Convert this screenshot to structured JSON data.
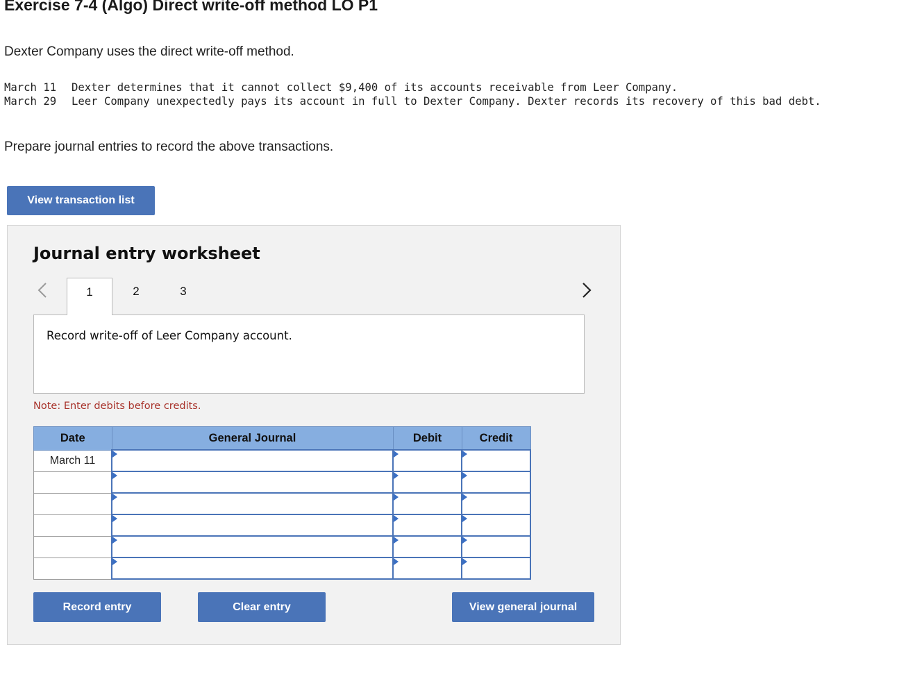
{
  "header": {
    "title": "Exercise 7-4 (Algo) Direct write-off method LO P1"
  },
  "intro": "Dexter Company uses the direct write-off method.",
  "transactions": [
    {
      "date": "March 11",
      "text": "Dexter determines that it cannot collect $9,400 of its accounts receivable from Leer Company."
    },
    {
      "date": "March 29",
      "text": "Leer Company unexpectedly pays its account in full to Dexter Company. Dexter records its recovery of this bad debt."
    }
  ],
  "instruction": "Prepare journal entries to record the above transactions.",
  "buttons": {
    "view_transaction_list": "View transaction list",
    "record_entry": "Record entry",
    "clear_entry": "Clear entry",
    "view_general_journal": "View general journal"
  },
  "worksheet": {
    "title": "Journal entry worksheet",
    "nav_prev_icon": "chevron-left-icon",
    "nav_next_icon": "chevron-right-icon",
    "tabs": [
      "1",
      "2",
      "3"
    ],
    "active_tab": "1",
    "description": "Record write-off of Leer Company account.",
    "note": "Note: Enter debits before credits.",
    "table": {
      "headers": [
        "Date",
        "General Journal",
        "Debit",
        "Credit"
      ],
      "rows": [
        {
          "date": "March 11",
          "account": "",
          "debit": "",
          "credit": ""
        },
        {
          "date": "",
          "account": "",
          "debit": "",
          "credit": ""
        },
        {
          "date": "",
          "account": "",
          "debit": "",
          "credit": ""
        },
        {
          "date": "",
          "account": "",
          "debit": "",
          "credit": ""
        },
        {
          "date": "",
          "account": "",
          "debit": "",
          "credit": ""
        },
        {
          "date": "",
          "account": "",
          "debit": "",
          "credit": ""
        }
      ]
    }
  },
  "colors": {
    "button_blue": "#4a74b8",
    "header_blue": "#86aee0",
    "note_red": "#a8322a",
    "panel_gray": "#f2f2f2"
  }
}
